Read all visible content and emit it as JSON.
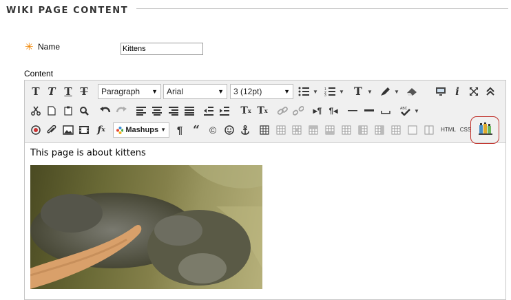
{
  "section": {
    "title": "WIKI PAGE CONTENT"
  },
  "name_field": {
    "label": "Name",
    "value": "Kittens"
  },
  "content_field": {
    "label": "Content"
  },
  "toolbar": {
    "paragraph": "Paragraph",
    "font": "Arial",
    "size": "3 (12pt)",
    "mashups": "Mashups",
    "html_label": "HTML",
    "css_label": "CSS"
  },
  "editor": {
    "text": "This page is about kittens",
    "image_alt": "kitten photo"
  },
  "colors": {
    "required_star": "#f08400",
    "highlight_ring": "#c0302a",
    "toolbar_bg": "#f0f0f0"
  }
}
